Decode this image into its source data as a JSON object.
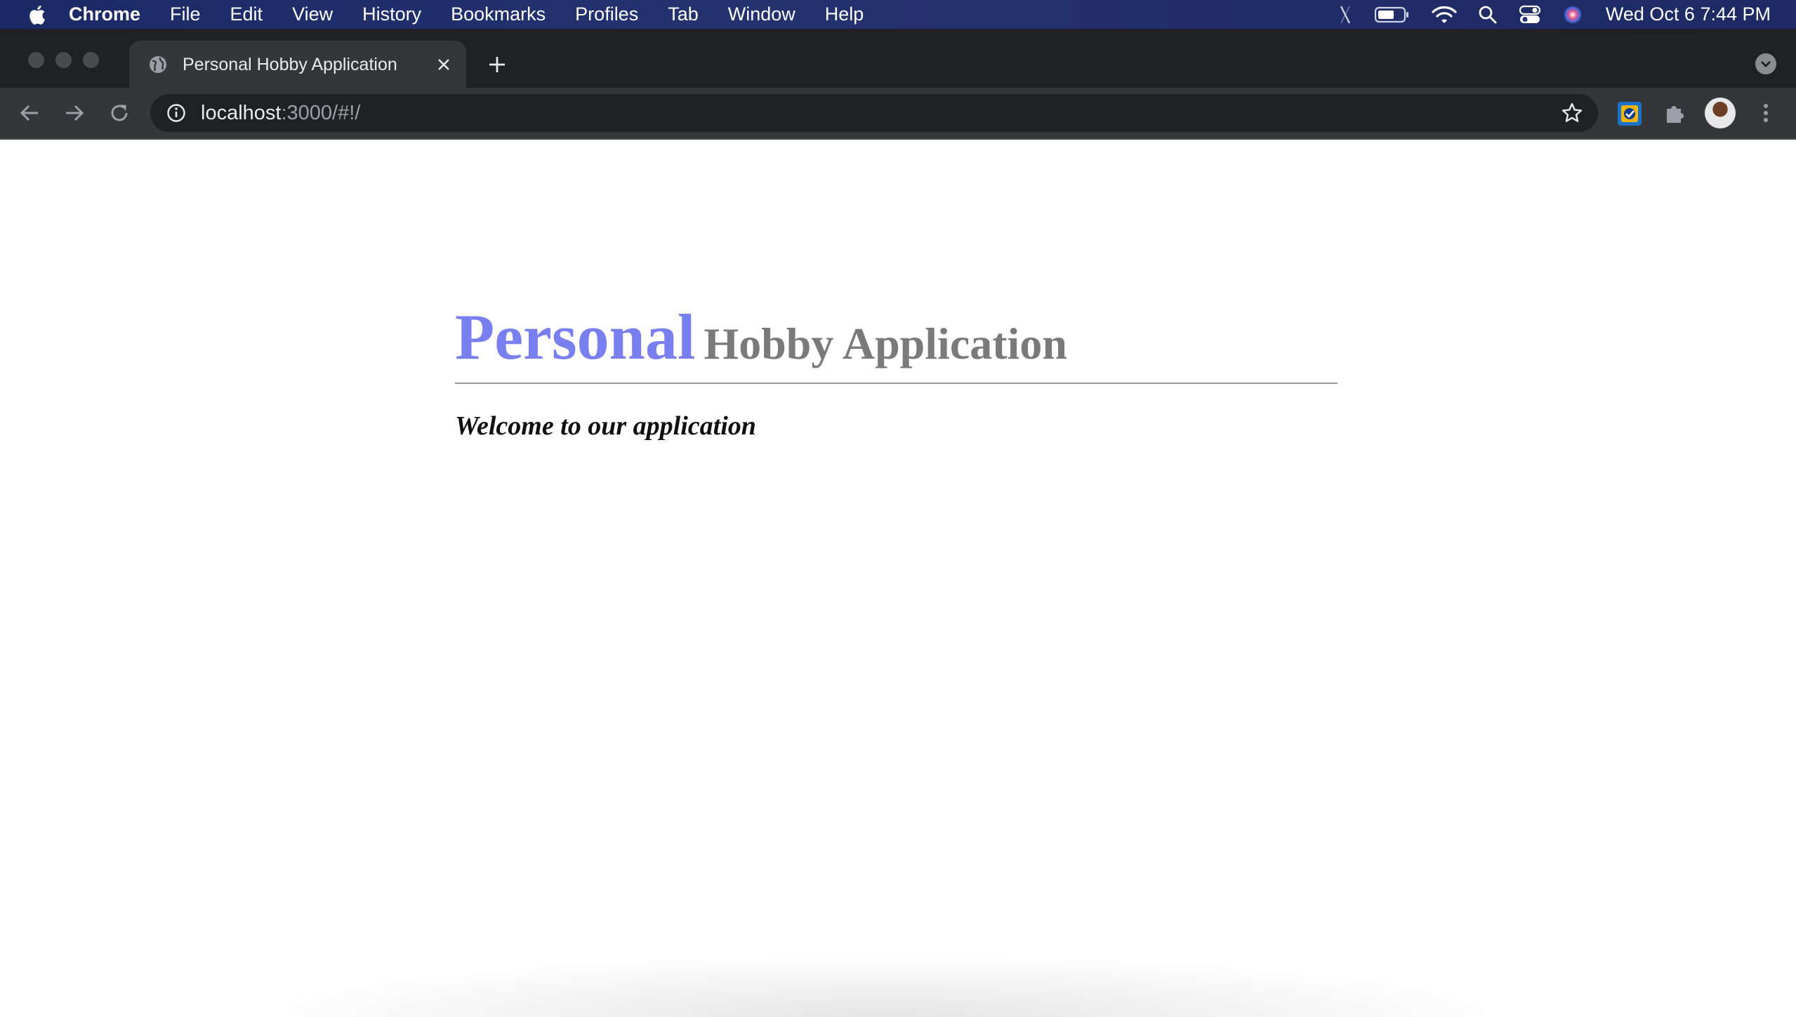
{
  "menubar": {
    "app_name": "Chrome",
    "items": [
      "File",
      "Edit",
      "View",
      "History",
      "Bookmarks",
      "Profiles",
      "Tab",
      "Window",
      "Help"
    ],
    "clock": "Wed Oct 6  7:44 PM"
  },
  "browser": {
    "tab": {
      "title": "Personal Hobby Application"
    },
    "address_bar": {
      "host": "localhost",
      "path": ":3000/#!/"
    }
  },
  "page": {
    "heading_primary": "Personal",
    "heading_secondary": "Hobby Application",
    "welcome": "Welcome to our application"
  },
  "colors": {
    "heading_primary": "#7a7fef",
    "heading_secondary": "#7a7a7a",
    "menubar_bg": "#1b2a66",
    "browser_frame": "#202124",
    "toolbar": "#35363a"
  },
  "icons": {
    "menubar": [
      "apple-icon",
      "mute-icon",
      "battery-icon",
      "wifi-icon",
      "spotlight-icon",
      "control-center-icon",
      "siri-icon"
    ],
    "browser": [
      "globe-favicon-icon",
      "close-tab-icon",
      "new-tab-icon",
      "tab-search-icon",
      "back-icon",
      "forward-icon",
      "reload-icon",
      "site-info-icon",
      "bookmark-star-icon",
      "extension-icon",
      "puzzle-extensions-icon",
      "profile-avatar",
      "more-menu-icon"
    ]
  }
}
